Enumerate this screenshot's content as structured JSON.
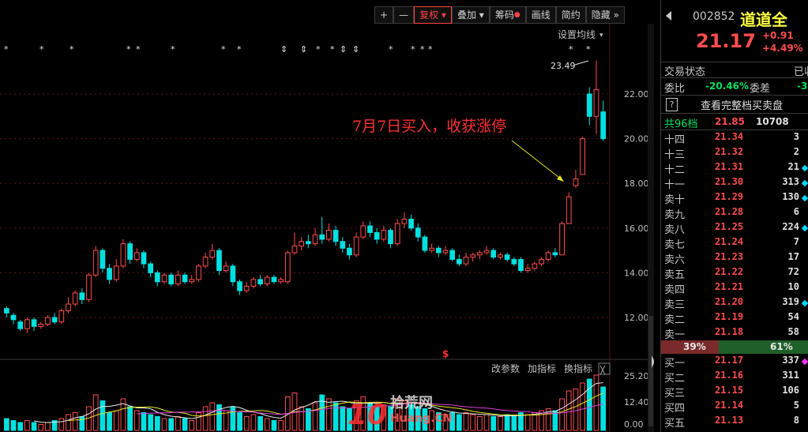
{
  "toolbar": {
    "plus": "+",
    "minus": "—",
    "fuquan": "复权",
    "diejia": "叠加",
    "chouma": "筹码",
    "huaxian": "画线",
    "jianyue": "简约",
    "yincang": "隐藏"
  },
  "chart": {
    "ma_setting": "设置均线",
    "max_label": "23.49",
    "annotation": "7月7日买入，收获涨停",
    "sub_tabs": [
      "改参数",
      "加指标",
      "换指标"
    ],
    "close_glyph": "╳",
    "watermark_big": "10",
    "watermark_cn": "拾荒网",
    "watermark_en": "Huang.CN",
    "marker": "$"
  },
  "chart_data": {
    "type": "candlestick",
    "ylim": [
      11.2,
      24.0
    ],
    "y_ticks": [
      "22.00",
      "20.00",
      "18.00",
      "16.00",
      "14.00",
      "12.00"
    ],
    "volume_ticks": [
      "25.20",
      "12.40",
      "0.00"
    ],
    "candles": [
      {
        "o": 12.4,
        "c": 12.2,
        "h": 12.5,
        "l": 12.0
      },
      {
        "o": 12.1,
        "c": 11.9,
        "h": 12.2,
        "l": 11.7
      },
      {
        "o": 11.8,
        "c": 11.5,
        "h": 11.9,
        "l": 11.4
      },
      {
        "o": 11.5,
        "c": 11.9,
        "h": 12.0,
        "l": 11.3
      },
      {
        "o": 11.9,
        "c": 11.6,
        "h": 12.0,
        "l": 11.4
      },
      {
        "o": 11.6,
        "c": 11.7,
        "h": 11.8,
        "l": 11.5
      },
      {
        "o": 11.7,
        "c": 12.0,
        "h": 12.1,
        "l": 11.6
      },
      {
        "o": 12.0,
        "c": 11.8,
        "h": 12.2,
        "l": 11.7
      },
      {
        "o": 11.8,
        "c": 12.3,
        "h": 12.4,
        "l": 11.7
      },
      {
        "o": 12.3,
        "c": 12.6,
        "h": 12.9,
        "l": 12.2
      },
      {
        "o": 12.6,
        "c": 13.1,
        "h": 13.2,
        "l": 12.5
      },
      {
        "o": 13.1,
        "c": 12.8,
        "h": 13.3,
        "l": 12.6
      },
      {
        "o": 12.8,
        "c": 13.9,
        "h": 14.0,
        "l": 12.7
      },
      {
        "o": 13.9,
        "c": 15.0,
        "h": 15.2,
        "l": 13.8
      },
      {
        "o": 15.0,
        "c": 14.2,
        "h": 15.1,
        "l": 14.0
      },
      {
        "o": 14.2,
        "c": 13.7,
        "h": 14.4,
        "l": 13.5
      },
      {
        "o": 13.7,
        "c": 14.3,
        "h": 14.6,
        "l": 13.6
      },
      {
        "o": 14.3,
        "c": 15.3,
        "h": 15.5,
        "l": 14.2
      },
      {
        "o": 15.3,
        "c": 14.6,
        "h": 15.4,
        "l": 14.4
      },
      {
        "o": 14.6,
        "c": 14.9,
        "h": 15.1,
        "l": 14.5
      },
      {
        "o": 14.9,
        "c": 14.4,
        "h": 15.0,
        "l": 14.2
      },
      {
        "o": 14.4,
        "c": 14.0,
        "h": 14.5,
        "l": 13.8
      },
      {
        "o": 14.0,
        "c": 13.6,
        "h": 14.1,
        "l": 13.4
      },
      {
        "o": 13.6,
        "c": 13.9,
        "h": 14.0,
        "l": 13.5
      },
      {
        "o": 13.9,
        "c": 13.5,
        "h": 14.0,
        "l": 13.4
      },
      {
        "o": 13.5,
        "c": 13.9,
        "h": 14.1,
        "l": 13.4
      },
      {
        "o": 13.9,
        "c": 13.6,
        "h": 14.0,
        "l": 13.5
      },
      {
        "o": 13.6,
        "c": 13.7,
        "h": 13.9,
        "l": 13.5
      },
      {
        "o": 13.7,
        "c": 14.3,
        "h": 14.4,
        "l": 13.6
      },
      {
        "o": 14.3,
        "c": 14.7,
        "h": 14.9,
        "l": 14.2
      },
      {
        "o": 14.7,
        "c": 15.0,
        "h": 15.3,
        "l": 14.6
      },
      {
        "o": 15.0,
        "c": 14.1,
        "h": 15.1,
        "l": 13.9
      },
      {
        "o": 14.1,
        "c": 14.3,
        "h": 14.5,
        "l": 14.0
      },
      {
        "o": 14.3,
        "c": 13.6,
        "h": 14.4,
        "l": 13.4
      },
      {
        "o": 13.6,
        "c": 13.2,
        "h": 13.7,
        "l": 13.0
      },
      {
        "o": 13.2,
        "c": 13.4,
        "h": 13.6,
        "l": 13.1
      },
      {
        "o": 13.4,
        "c": 13.7,
        "h": 13.8,
        "l": 13.3
      },
      {
        "o": 13.7,
        "c": 13.5,
        "h": 13.9,
        "l": 13.4
      },
      {
        "o": 13.5,
        "c": 13.8,
        "h": 13.9,
        "l": 13.4
      },
      {
        "o": 13.8,
        "c": 13.6,
        "h": 13.9,
        "l": 13.5
      },
      {
        "o": 13.6,
        "c": 13.7,
        "h": 13.8,
        "l": 13.5
      },
      {
        "o": 13.6,
        "c": 14.9,
        "h": 15.0,
        "l": 13.5
      },
      {
        "o": 14.9,
        "c": 15.2,
        "h": 15.8,
        "l": 14.8
      },
      {
        "o": 15.2,
        "c": 15.4,
        "h": 15.6,
        "l": 15.0
      },
      {
        "o": 15.4,
        "c": 15.3,
        "h": 15.7,
        "l": 15.1
      },
      {
        "o": 15.3,
        "c": 15.7,
        "h": 16.0,
        "l": 15.2
      },
      {
        "o": 15.7,
        "c": 15.5,
        "h": 16.5,
        "l": 15.3
      },
      {
        "o": 15.5,
        "c": 15.9,
        "h": 16.2,
        "l": 15.4
      },
      {
        "o": 15.9,
        "c": 15.4,
        "h": 16.1,
        "l": 15.2
      },
      {
        "o": 15.4,
        "c": 15.1,
        "h": 15.6,
        "l": 14.9
      },
      {
        "o": 15.1,
        "c": 14.8,
        "h": 15.3,
        "l": 14.6
      },
      {
        "o": 14.8,
        "c": 15.6,
        "h": 15.8,
        "l": 14.7
      },
      {
        "o": 15.6,
        "c": 16.1,
        "h": 16.3,
        "l": 15.5
      },
      {
        "o": 16.1,
        "c": 15.8,
        "h": 16.3,
        "l": 15.6
      },
      {
        "o": 15.8,
        "c": 15.5,
        "h": 16.0,
        "l": 15.3
      },
      {
        "o": 15.5,
        "c": 15.9,
        "h": 16.1,
        "l": 15.4
      },
      {
        "o": 15.9,
        "c": 15.3,
        "h": 16.0,
        "l": 15.1
      },
      {
        "o": 15.3,
        "c": 16.2,
        "h": 16.4,
        "l": 15.2
      },
      {
        "o": 16.2,
        "c": 16.4,
        "h": 16.7,
        "l": 16.0
      },
      {
        "o": 16.4,
        "c": 16.0,
        "h": 16.6,
        "l": 15.9
      },
      {
        "o": 16.0,
        "c": 15.6,
        "h": 16.2,
        "l": 15.4
      },
      {
        "o": 15.6,
        "c": 15.0,
        "h": 15.7,
        "l": 14.9
      },
      {
        "o": 15.0,
        "c": 15.1,
        "h": 15.3,
        "l": 14.9
      },
      {
        "o": 15.1,
        "c": 14.9,
        "h": 15.2,
        "l": 14.7
      },
      {
        "o": 14.9,
        "c": 15.0,
        "h": 15.2,
        "l": 14.8
      },
      {
        "o": 15.0,
        "c": 14.6,
        "h": 15.1,
        "l": 14.5
      },
      {
        "o": 14.6,
        "c": 14.4,
        "h": 14.8,
        "l": 14.3
      },
      {
        "o": 14.4,
        "c": 14.7,
        "h": 14.9,
        "l": 14.3
      },
      {
        "o": 14.7,
        "c": 14.8,
        "h": 14.9,
        "l": 14.5
      },
      {
        "o": 14.8,
        "c": 14.9,
        "h": 15.0,
        "l": 14.6
      },
      {
        "o": 14.9,
        "c": 15.0,
        "h": 15.2,
        "l": 14.8
      },
      {
        "o": 15.0,
        "c": 14.7,
        "h": 15.1,
        "l": 14.6
      },
      {
        "o": 14.7,
        "c": 14.8,
        "h": 14.9,
        "l": 14.6
      },
      {
        "o": 14.8,
        "c": 14.6,
        "h": 14.9,
        "l": 14.5
      },
      {
        "o": 14.6,
        "c": 14.4,
        "h": 14.7,
        "l": 14.3
      },
      {
        "o": 14.6,
        "c": 14.1,
        "h": 14.7,
        "l": 14.0
      },
      {
        "o": 14.1,
        "c": 14.2,
        "h": 14.4,
        "l": 14.0
      },
      {
        "o": 14.2,
        "c": 14.4,
        "h": 14.5,
        "l": 14.1
      },
      {
        "o": 14.4,
        "c": 14.6,
        "h": 14.7,
        "l": 14.3
      },
      {
        "o": 14.6,
        "c": 14.9,
        "h": 15.0,
        "l": 14.5
      },
      {
        "o": 14.9,
        "c": 14.8,
        "h": 15.1,
        "l": 14.7
      },
      {
        "o": 14.8,
        "c": 16.2,
        "h": 16.3,
        "l": 14.8
      },
      {
        "o": 16.2,
        "c": 17.4,
        "h": 17.6,
        "l": 16.2
      },
      {
        "o": 17.9,
        "c": 18.2,
        "h": 18.6,
        "l": 17.8
      },
      {
        "o": 18.4,
        "c": 20.0,
        "h": 20.1,
        "l": 18.4
      },
      {
        "o": 22.0,
        "c": 21.0,
        "h": 22.3,
        "l": 20.6
      },
      {
        "o": 21.0,
        "c": 22.2,
        "h": 23.5,
        "l": 20.2
      },
      {
        "o": 21.2,
        "c": 20.0,
        "h": 21.7,
        "l": 19.9
      }
    ],
    "volumes": [
      6,
      5,
      4,
      5,
      4,
      3,
      4,
      5,
      6,
      8,
      9,
      7,
      12,
      18,
      15,
      9,
      10,
      16,
      12,
      10,
      9,
      8,
      7,
      6,
      6,
      7,
      6,
      5,
      9,
      12,
      14,
      13,
      10,
      12,
      9,
      7,
      8,
      7,
      6,
      5,
      5,
      17,
      19,
      12,
      11,
      14,
      18,
      16,
      14,
      12,
      11,
      15,
      17,
      14,
      12,
      13,
      12,
      16,
      15,
      13,
      12,
      11,
      10,
      9,
      8,
      9,
      8,
      9,
      8,
      7,
      8,
      7,
      7,
      8,
      7,
      9,
      8,
      9,
      10,
      11,
      10,
      16,
      20,
      21,
      24,
      26,
      28,
      22
    ],
    "star_markers": [
      "*",
      "*",
      "*",
      "*",
      "*",
      "*",
      "*",
      "*",
      "⇕",
      "⇕",
      "*",
      "*",
      "⇕",
      "⇕",
      "*",
      "*",
      "*",
      "*",
      "*",
      "*"
    ]
  },
  "quote": {
    "code": "002852",
    "name": "道道全",
    "price": "21.17",
    "change": "+0.91",
    "change_pct": "+4.49%",
    "status_label": "交易状态",
    "status_value": "已收",
    "weibi_label": "委比",
    "weibi_value": "-20.46%",
    "weicha_label": "委差",
    "weicha_value": "-3",
    "full_book_label": "查看完整档买卖盘",
    "help": "?",
    "total_label": "共96档",
    "total_price": "21.85",
    "total_qty": "10708",
    "sell_ratio": "39%",
    "buy_ratio": "61%",
    "up_color": "#ff4d4d",
    "down_color": "#00e0e0"
  },
  "orderbook": {
    "asks": [
      {
        "label": "十四",
        "price": "21.34",
        "qty": "3",
        "dot": ""
      },
      {
        "label": "十三",
        "price": "21.32",
        "qty": "2",
        "dot": ""
      },
      {
        "label": "十二",
        "price": "21.31",
        "qty": "21",
        "dot": "cyan"
      },
      {
        "label": "十一",
        "price": "21.30",
        "qty": "313",
        "dot": "cyan"
      },
      {
        "label": "卖十",
        "price": "21.29",
        "qty": "130",
        "dot": "cyan"
      },
      {
        "label": "卖九",
        "price": "21.28",
        "qty": "6",
        "dot": ""
      },
      {
        "label": "卖八",
        "price": "21.25",
        "qty": "224",
        "dot": "cyan"
      },
      {
        "label": "卖七",
        "price": "21.24",
        "qty": "7",
        "dot": ""
      },
      {
        "label": "卖六",
        "price": "21.23",
        "qty": "17",
        "dot": ""
      },
      {
        "label": "卖五",
        "price": "21.22",
        "qty": "72",
        "dot": ""
      },
      {
        "label": "卖四",
        "price": "21.21",
        "qty": "10",
        "dot": ""
      },
      {
        "label": "卖三",
        "price": "21.20",
        "qty": "319",
        "dot": "cyan"
      },
      {
        "label": "卖二",
        "price": "21.19",
        "qty": "54",
        "dot": ""
      },
      {
        "label": "卖一",
        "price": "21.18",
        "qty": "58",
        "dot": ""
      }
    ],
    "bids": [
      {
        "label": "买一",
        "price": "21.17",
        "qty": "337",
        "dot": "magenta"
      },
      {
        "label": "买二",
        "price": "21.16",
        "qty": "311",
        "dot": ""
      },
      {
        "label": "买三",
        "price": "21.15",
        "qty": "106",
        "dot": ""
      },
      {
        "label": "买四",
        "price": "21.14",
        "qty": "5",
        "dot": ""
      },
      {
        "label": "买五",
        "price": "21.13",
        "qty": "8",
        "dot": ""
      }
    ]
  }
}
